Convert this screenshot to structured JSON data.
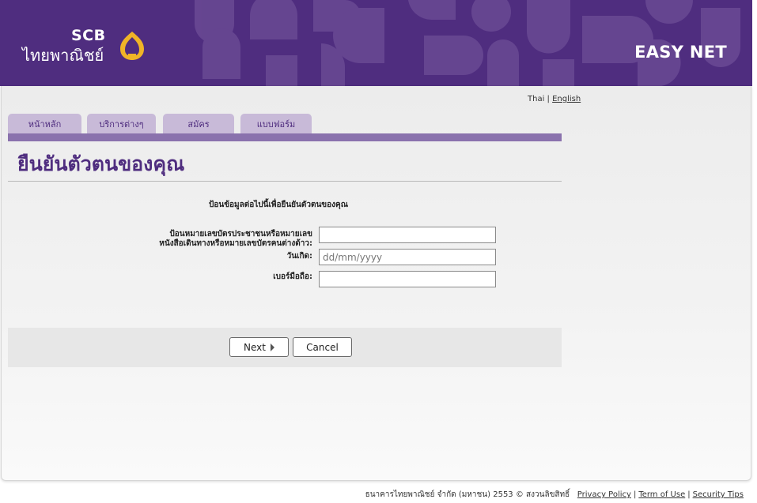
{
  "header": {
    "logo_scb": "SCB",
    "logo_thai": "ไทยพาณิชย์",
    "brand": "EASY NET",
    "colors": {
      "primary": "#4f2d7f",
      "logo_gold": "#f0b427"
    }
  },
  "language": {
    "thai": "Thai",
    "separator": "|",
    "english": "English"
  },
  "tabs": [
    {
      "label": "หน้าหลัก"
    },
    {
      "label": "บริการต่างๆ"
    },
    {
      "label": "สมัคร"
    },
    {
      "label": "แบบฟอร์ม"
    }
  ],
  "page": {
    "title": "ยืนยันตัวตนของคุณ",
    "instruction": "ป้อนข้อมูลต่อไปนี้เพื่อยืนยันตัวตนของคุณ"
  },
  "form": {
    "id_label_line1": "ป้อนหมายเลขบัตรประชาชนหรือหมายเลข",
    "id_label_line2": "หนังสือเดินทางหรือหมายเลขบัตรคนต่างด้าว:",
    "id_value": "",
    "dob_label": "วันเกิด:",
    "dob_placeholder": "dd/mm/yyyy",
    "mobile_label": "เบอร์มือถือ:",
    "mobile_value": ""
  },
  "buttons": {
    "next": "Next",
    "cancel": "Cancel"
  },
  "footer": {
    "copyright": "ธนาคารไทยพาณิชย์ จำกัด (มหาชน) 2553 © สงวนลิขสิทธิ์",
    "privacy": "Privacy Policy",
    "terms": "Term of Use",
    "security": "Security Tips",
    "separator": "|"
  }
}
